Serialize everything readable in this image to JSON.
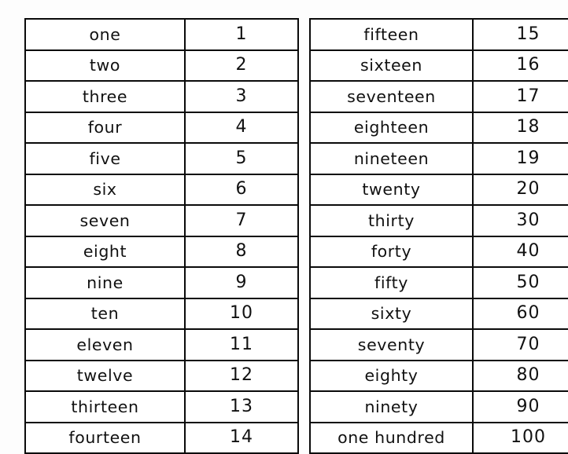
{
  "document": {
    "kind": "number-words-reference-table",
    "background_color": "#fdfdfd",
    "border_color": "#0a0a0a",
    "text_color": "#111111"
  },
  "tables": [
    {
      "id": "left-table",
      "columns": [
        "word",
        "numeral"
      ],
      "rows": [
        {
          "word": "one",
          "numeral": "1"
        },
        {
          "word": "two",
          "numeral": "2"
        },
        {
          "word": "three",
          "numeral": "3"
        },
        {
          "word": "four",
          "numeral": "4"
        },
        {
          "word": "five",
          "numeral": "5"
        },
        {
          "word": "six",
          "numeral": "6"
        },
        {
          "word": "seven",
          "numeral": "7"
        },
        {
          "word": "eight",
          "numeral": "8"
        },
        {
          "word": "nine",
          "numeral": "9"
        },
        {
          "word": "ten",
          "numeral": "10"
        },
        {
          "word": "eleven",
          "numeral": "11"
        },
        {
          "word": "twelve",
          "numeral": "12"
        },
        {
          "word": "thirteen",
          "numeral": "13"
        },
        {
          "word": "fourteen",
          "numeral": "14"
        }
      ]
    },
    {
      "id": "right-table",
      "columns": [
        "word",
        "numeral"
      ],
      "rows": [
        {
          "word": "fifteen",
          "numeral": "15"
        },
        {
          "word": "sixteen",
          "numeral": "16"
        },
        {
          "word": "seventeen",
          "numeral": "17"
        },
        {
          "word": "eighteen",
          "numeral": "18"
        },
        {
          "word": "nineteen",
          "numeral": "19"
        },
        {
          "word": "twenty",
          "numeral": "20"
        },
        {
          "word": "thirty",
          "numeral": "30"
        },
        {
          "word": "forty",
          "numeral": "40"
        },
        {
          "word": "fifty",
          "numeral": "50"
        },
        {
          "word": "sixty",
          "numeral": "60"
        },
        {
          "word": "seventy",
          "numeral": "70"
        },
        {
          "word": "eighty",
          "numeral": "80"
        },
        {
          "word": "ninety",
          "numeral": "90"
        },
        {
          "word": "one hundred",
          "numeral": "100"
        }
      ]
    }
  ]
}
